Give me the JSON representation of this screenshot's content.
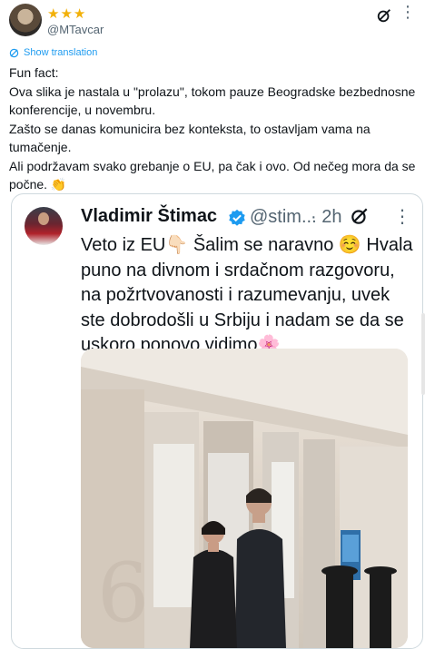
{
  "author": {
    "name": "★★★",
    "handle": "@MTavcar"
  },
  "show_translation": "Show translation",
  "tweet_text": "Fun fact:\nOva slika je nastala u \"prolazu\", tokom pauze Beogradske bezbednosne konferencije, u novembru.\nZašto se danas komunicira bez konteksta, to ostavljam vama na tumačenje.\nAli podržavam svako grebanje o EU, pa čak i ovo. Od nečeg mora da se počne. 👏",
  "quoted": {
    "name": "Vladimir Štimac",
    "handle": "@stim...",
    "time": "· 2h",
    "text": "Veto iz EU👇🏻 Šalim se naravno ☺️ Hvala puno na divnom i srdačnom razgovoru, na požrtvovanosti i razumevanju, uvek ste dobrodošli u Srbiju i nadam se da se uskoro ponovo vidimo🌸",
    "photo_number": "6"
  },
  "colors": {
    "accent": "#1d9bf0",
    "muted": "#536471",
    "text": "#0f1419",
    "border": "#cfd9de"
  },
  "icons": [
    "avatar",
    "grok-icon",
    "more-icon",
    "translate-icon",
    "verified-icon"
  ]
}
